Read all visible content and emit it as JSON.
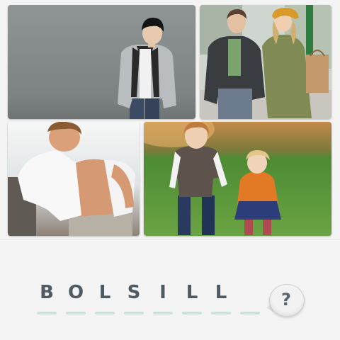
{
  "photos": [
    {
      "subject": "young-man-grey-jacket"
    },
    {
      "subject": "couple-walking-shopping"
    },
    {
      "subject": "shirtless-young-man-white-shirt"
    },
    {
      "subject": "two-children-in-park"
    }
  ],
  "answer": {
    "letters": [
      "B",
      "O",
      "L",
      "S",
      "I",
      "L",
      "L",
      ""
    ]
  },
  "hint": {
    "symbol": "?",
    "icon": "question-bubble-icon"
  },
  "colors": {
    "letter": "#4f5a63",
    "slot_line": "#cfe0dc",
    "background": "#f4f4f4"
  }
}
